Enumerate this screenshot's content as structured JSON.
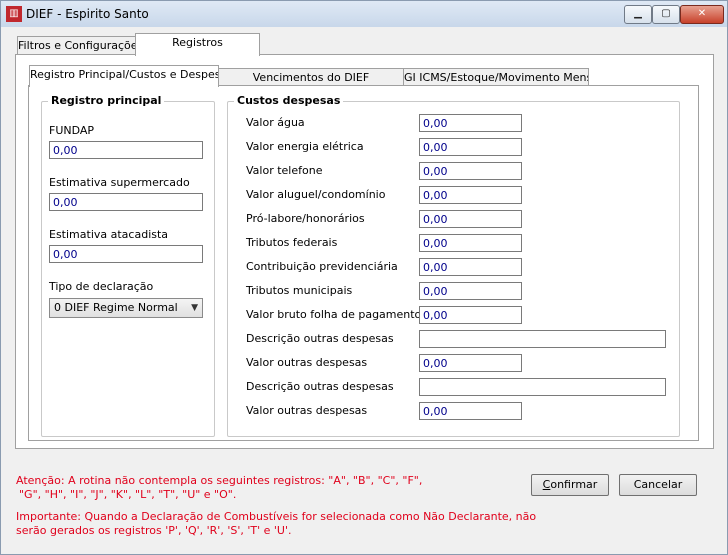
{
  "window": {
    "title": "DIEF - Espirito Santo",
    "icon": "dief-app-icon",
    "minimize_glyph": "▁",
    "maximize_glyph": "▢",
    "close_glyph": "✕"
  },
  "top_tabs": [
    "Filtros e Configurações",
    "Registros"
  ],
  "sub_tabs": [
    "Registro Principal/Custos e Despesas",
    "Vencimentos do DIEF",
    "GI ICMS/Estoque/Movimento Mensal"
  ],
  "registro_principal": {
    "title": "Registro principal",
    "fundap_label": "FUNDAP",
    "fundap_value": "0,00",
    "est_super_label": "Estimativa supermercado",
    "est_super_value": "0,00",
    "est_atac_label": "Estimativa atacadista",
    "est_atac_value": "0,00",
    "tipo_label": "Tipo de declaração",
    "tipo_value": "0 DIEF Regime Normal"
  },
  "custos": {
    "title": "Custos despesas",
    "rows": [
      {
        "label": "Valor água",
        "value": "0,00"
      },
      {
        "label": "Valor energia elétrica",
        "value": "0,00"
      },
      {
        "label": "Valor telefone",
        "value": "0,00"
      },
      {
        "label": "Valor aluguel/condomínio",
        "value": "0,00"
      },
      {
        "label": "Pró-labore/honorários",
        "value": "0,00"
      },
      {
        "label": "Tributos federais",
        "value": "0,00"
      },
      {
        "label": "Contribuição previdenciária",
        "value": "0,00"
      },
      {
        "label": "Tributos municipais",
        "value": "0,00"
      },
      {
        "label": "Valor bruto folha de pagamento",
        "value": "0,00"
      },
      {
        "label": "Descrição outras despesas",
        "value": ""
      },
      {
        "label": "Valor outras despesas",
        "value": "0,00"
      },
      {
        "label": "Descrição outras despesas",
        "value": ""
      },
      {
        "label": "Valor outras despesas",
        "value": "0,00"
      }
    ]
  },
  "notes": {
    "attention_line1": "Atenção: A rotina não contempla os seguintes registros: \"A\", \"B\", \"C\", \"F\",",
    "attention_line2": "\"G\", \"H\", \"I\", \"J\", \"K\", \"L\", \"T\", \"U\" e \"O\".",
    "important_line1": "Importante: Quando a Declaração de Combustíveis for selecionada como Não Declarante, não",
    "important_line2": "serão gerados os registros 'P', 'Q', 'R', 'S', 'T' e 'U'."
  },
  "buttons": {
    "confirm_first": "C",
    "confirm_rest": "onfirmar",
    "cancel": "Cancelar"
  }
}
